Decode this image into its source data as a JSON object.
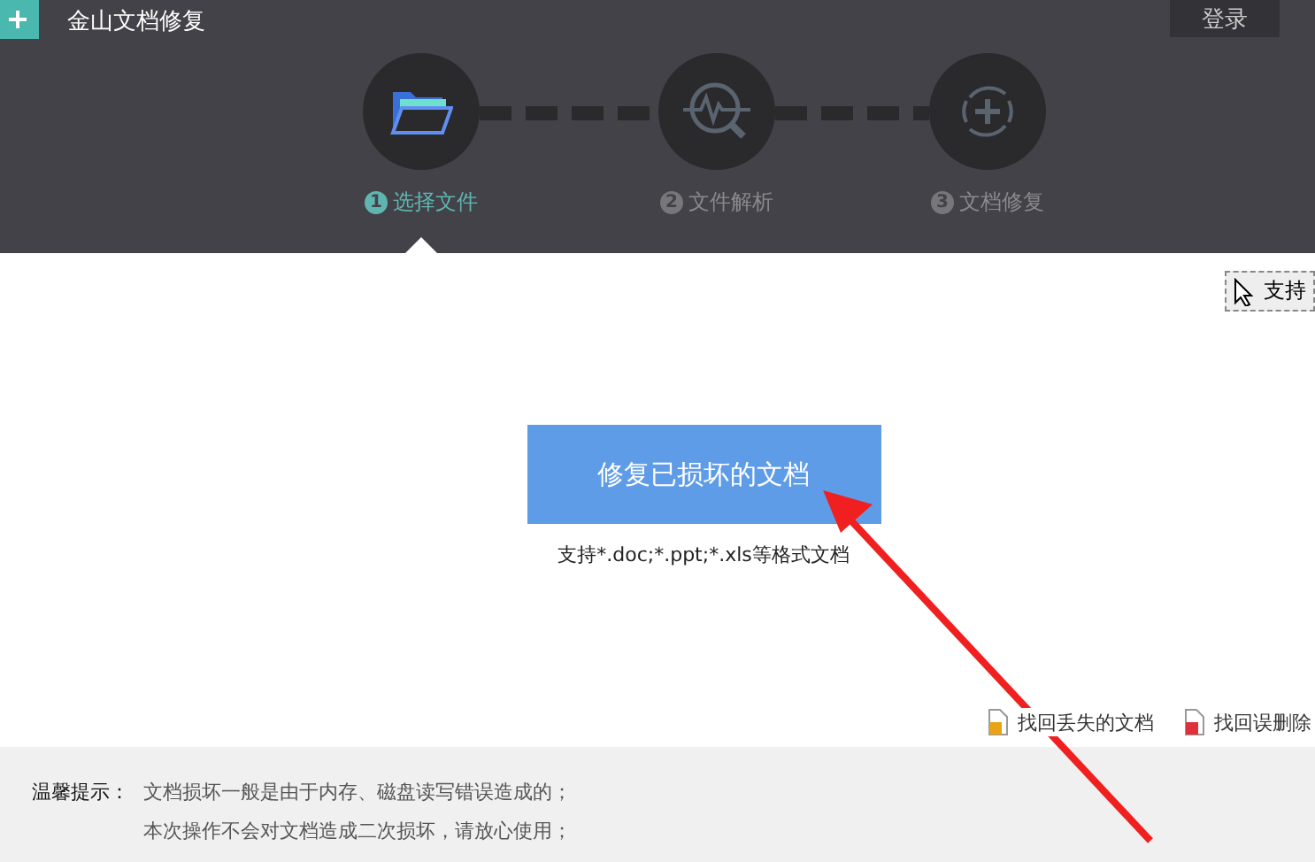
{
  "window": {
    "title": "金山文档修复",
    "login": "登录"
  },
  "steps": [
    {
      "number": "1",
      "label": "选择文件",
      "selected": true,
      "kind": "folder"
    },
    {
      "number": "2",
      "label": "文件解析",
      "selected": false,
      "kind": "scan"
    },
    {
      "number": "3",
      "label": "文档修复",
      "selected": false,
      "kind": "repair"
    }
  ],
  "tooltip": "支持",
  "main_button": "修复已损坏的文档",
  "support_text": "支持*.doc;*.ppt;*.xls等格式文档",
  "links": [
    {
      "label": "找回丢失的文档",
      "kind": "lost"
    },
    {
      "label": "找回误删除",
      "kind": "deleted"
    }
  ],
  "tips": {
    "label": "温馨提示：",
    "lines": [
      "文档损坏一般是由于内存、磁盘读写错误造成的；",
      "本次操作不会对文档造成二次损坏，请放心使用；"
    ]
  }
}
